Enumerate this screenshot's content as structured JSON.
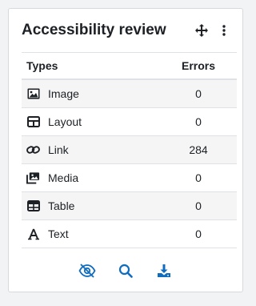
{
  "block": {
    "title": "Accessibility review",
    "move_icon": "move-arrows-icon",
    "menu_icon": "kebab-menu-icon"
  },
  "table": {
    "headers": {
      "types": "Types",
      "errors": "Errors"
    },
    "rows": [
      {
        "type": "Image",
        "errors": "0",
        "icon": "image-icon"
      },
      {
        "type": "Layout",
        "errors": "0",
        "icon": "layout-grid-icon"
      },
      {
        "type": "Link",
        "errors": "284",
        "icon": "link-icon"
      },
      {
        "type": "Media",
        "errors": "0",
        "icon": "media-icon"
      },
      {
        "type": "Table",
        "errors": "0",
        "icon": "table-icon"
      },
      {
        "type": "Text",
        "errors": "0",
        "icon": "text-icon"
      }
    ]
  },
  "footer": {
    "icons": [
      "eye-slash-icon",
      "search-icon",
      "download-icon"
    ]
  },
  "colors": {
    "accent": "#0f6cbf",
    "text": "#1d2125",
    "border": "#dee2e6",
    "stripe": "#f5f5f5"
  }
}
